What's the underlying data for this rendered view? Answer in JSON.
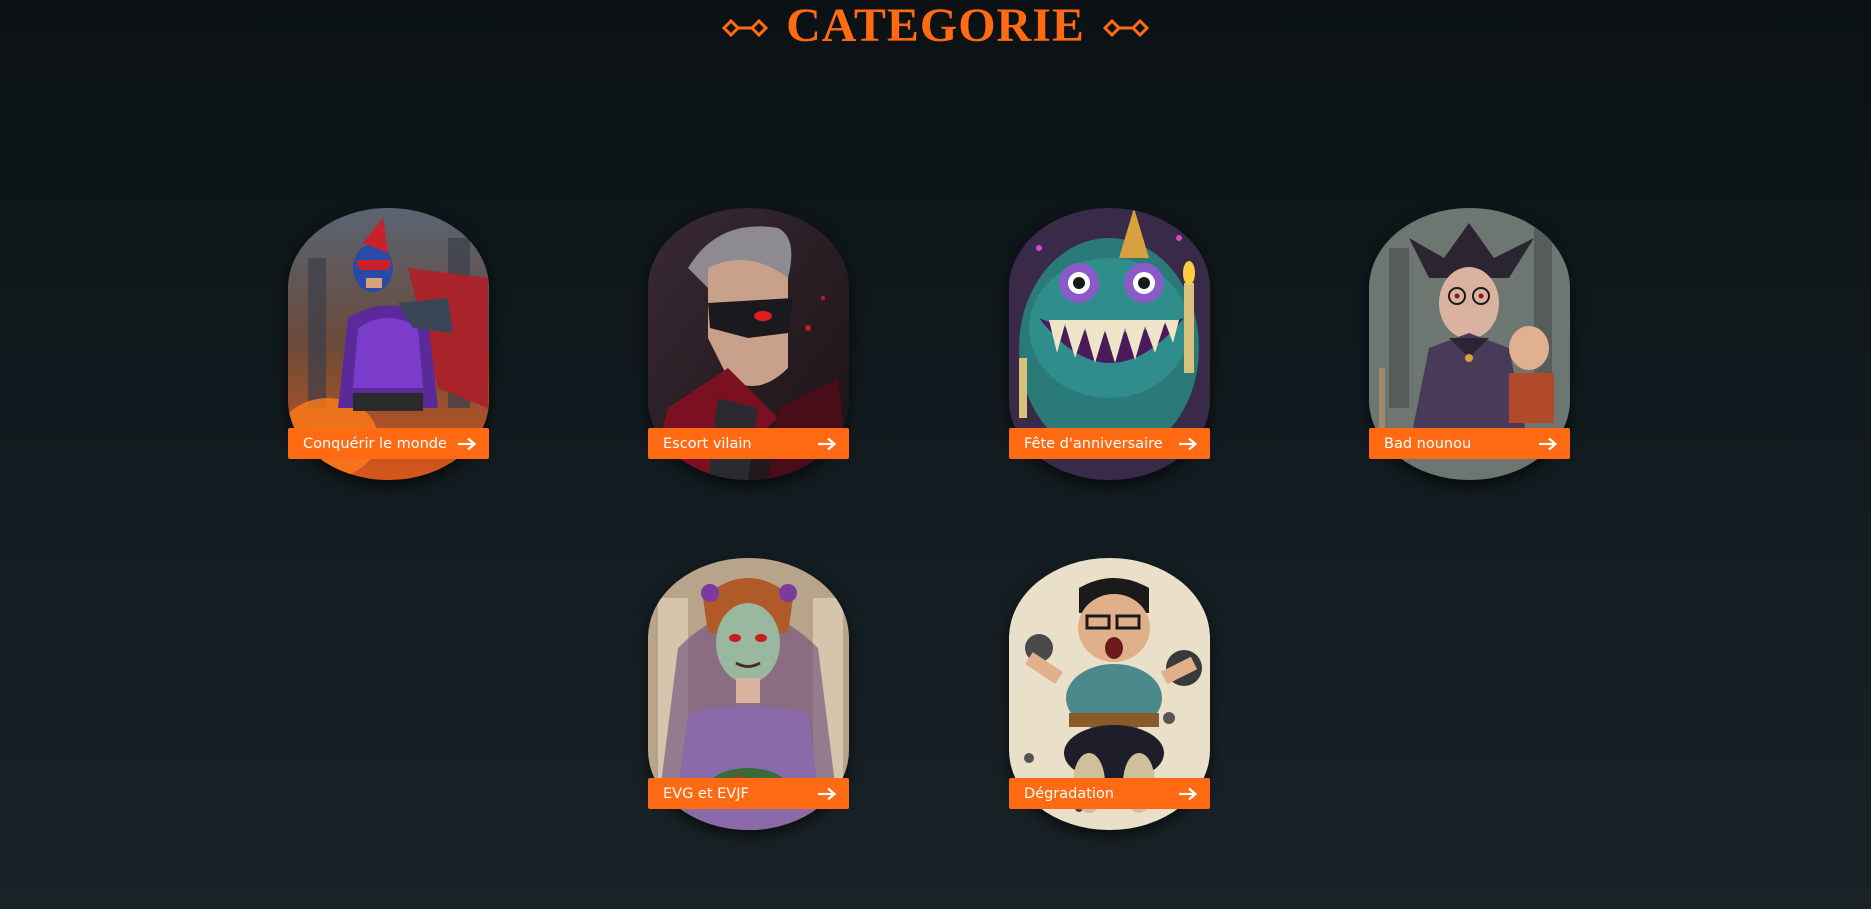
{
  "header": {
    "title": "CATEGORIE",
    "accent_color": "#ff6a13"
  },
  "categories": [
    {
      "label": "Conquérir le monde",
      "icon": "arrow-right-icon",
      "art": "supervillain-portrait"
    },
    {
      "label": "Escort vilain",
      "icon": "arrow-right-icon",
      "art": "masked-villain-portrait"
    },
    {
      "label": "Fête d'anniversaire",
      "icon": "arrow-right-icon",
      "art": "party-monster-portrait"
    },
    {
      "label": "Bad nounou",
      "icon": "arrow-right-icon",
      "art": "evil-nanny-portrait"
    },
    {
      "label": "EVG et EVJF",
      "icon": "arrow-right-icon",
      "art": "zombie-bride-portrait"
    },
    {
      "label": "Dégradation",
      "icon": "arrow-right-icon",
      "art": "angry-kid-portrait"
    }
  ]
}
